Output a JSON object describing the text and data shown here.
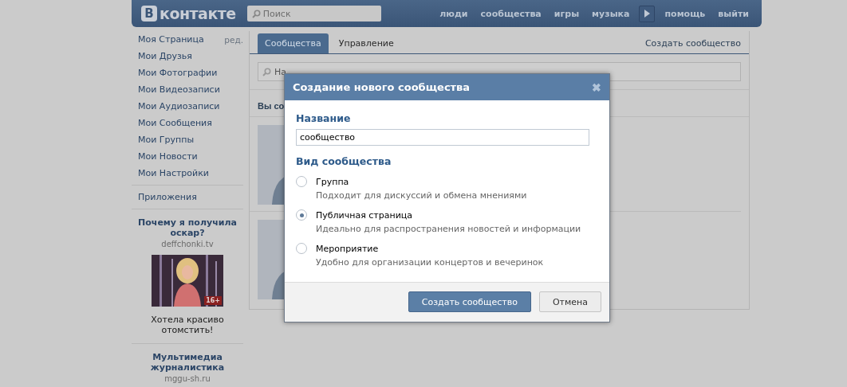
{
  "header": {
    "logo_badge": "В",
    "logo_text": "контакте",
    "search": {
      "placeholder": "Поиск"
    },
    "nav": [
      "люди",
      "сообщества",
      "игры",
      "музыка"
    ],
    "nav_right": [
      "помощь",
      "выйти"
    ]
  },
  "sidebar": {
    "items": [
      {
        "label": "Моя Страница",
        "edit": "ред."
      },
      {
        "label": "Мои Друзья"
      },
      {
        "label": "Мои Фотографии"
      },
      {
        "label": "Мои Видеозаписи"
      },
      {
        "label": "Мои Аудиозаписи"
      },
      {
        "label": "Мои Сообщения"
      },
      {
        "label": "Мои Группы"
      },
      {
        "label": "Мои Новости"
      },
      {
        "label": "Мои Настройки"
      }
    ],
    "apps": "Приложения",
    "ads": [
      {
        "title": "Почему я получила оскар?",
        "domain": "deffchonki.tv",
        "picture": {
          "kind": "picture",
          "badge": "16+"
        },
        "caption": "Хотела красиво отомстить!"
      },
      {
        "title": "Мультимедиа журналистика",
        "domain": "mggu-sh.ru"
      }
    ]
  },
  "content": {
    "tabs": [
      {
        "label": "Сообщества",
        "selected": true
      },
      {
        "label": "Управление",
        "selected": false
      }
    ],
    "create_link": "Создать сообщество",
    "search": {
      "placeholder": "На"
    },
    "heading": "Вы со"
  },
  "dialog": {
    "title": "Создание нового сообщества",
    "close": "✖",
    "name_label": "Название",
    "name_value": "сообщество",
    "type_label": "Вид сообщества",
    "options": [
      {
        "label": "Группа",
        "description": "Подходит для дискуссий и обмена мнениями",
        "selected": false
      },
      {
        "label": "Публичная страница",
        "description": "Идеально для распространения новостей и информации",
        "selected": true
      },
      {
        "label": "Мероприятие",
        "description": "Удобно для организации концертов и вечеринок",
        "selected": false
      }
    ],
    "submit": "Создать сообщество",
    "cancel": "Отмена"
  }
}
